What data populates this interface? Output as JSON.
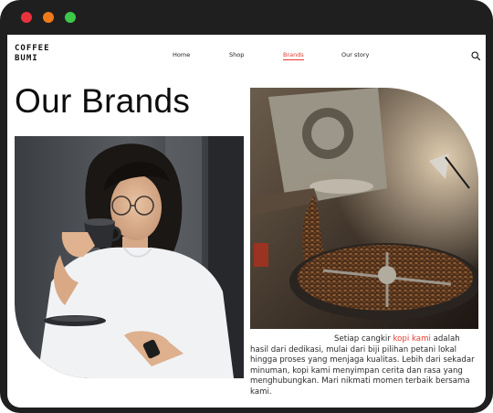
{
  "window": {
    "controls": [
      "close",
      "minimize",
      "maximize"
    ]
  },
  "brand": {
    "logo_line1": "COFFEE",
    "logo_line2": "BUMI"
  },
  "nav": {
    "items": [
      {
        "label": "Home",
        "active": false
      },
      {
        "label": "Shop",
        "active": false
      },
      {
        "label": "Brands",
        "active": true
      },
      {
        "label": "Our story",
        "active": false
      }
    ],
    "search_icon": "search-icon"
  },
  "main": {
    "title": "Our Brands",
    "photo_left": "woman-drinking-coffee-photo",
    "photo_right": "coffee-roaster-photo",
    "paragraph": {
      "before": "Setiap cangkir ",
      "highlight": "kopi kami",
      "after": " adalah hasil dari dedikasi, mulai dari biji pilihan petani lokal hingga proses yang menjaga kualitas. Lebih dari sekadar minuman, kopi kami menyimpan cerita dan rasa yang menghubungkan. Mari nikmati momen terbaik bersama kami."
    }
  },
  "colors": {
    "accent": "#e83a2e",
    "frame": "#1f1f1f"
  }
}
